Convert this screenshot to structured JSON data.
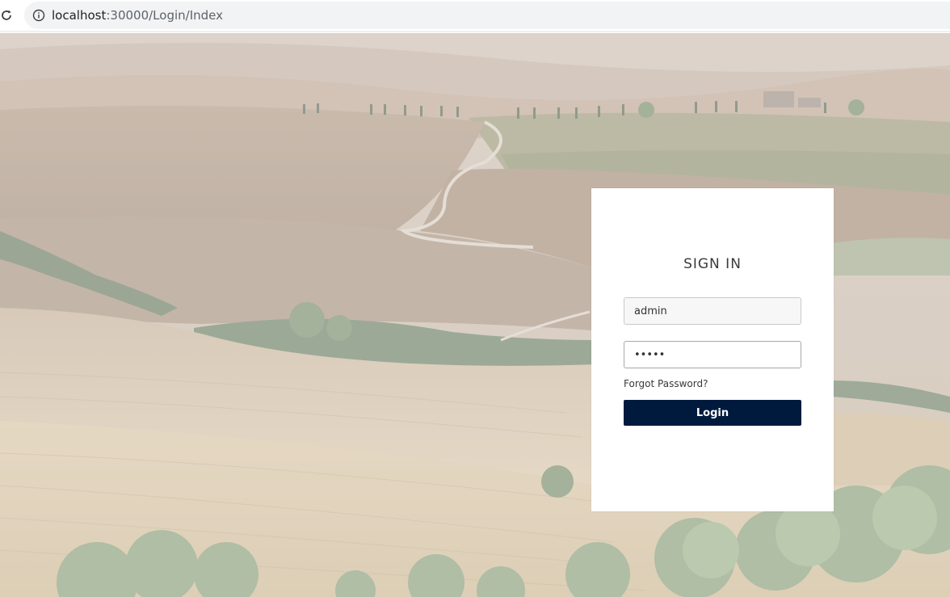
{
  "browser": {
    "url_host": "localhost",
    "url_path": ":30000/Login/Index",
    "reload_icon": "reload-icon",
    "info_icon": "info-icon"
  },
  "login": {
    "title": "SIGN IN",
    "username": {
      "value": "admin"
    },
    "password": {
      "value": "•••••"
    },
    "forgot_label": "Forgot Password?",
    "submit_label": "Login"
  },
  "colors": {
    "button": "#001a3d",
    "card": "#ffffff"
  }
}
